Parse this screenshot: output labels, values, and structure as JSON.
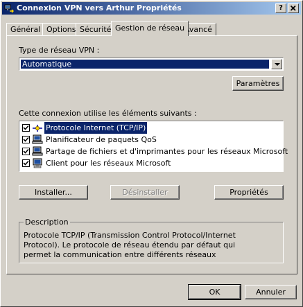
{
  "window": {
    "title": "Connexion VPN vers Arthur Propriétés",
    "help_button": "?",
    "close_button": "✕"
  },
  "tabs": [
    {
      "label": "Général",
      "active": false
    },
    {
      "label": "Options",
      "active": false
    },
    {
      "label": "Sécurité",
      "active": false
    },
    {
      "label": "Gestion de réseau",
      "active": true
    },
    {
      "label": "Avancé",
      "active": false
    }
  ],
  "vpn_type": {
    "label": "Type de réseau VPN :",
    "selected": "Automatique",
    "settings_button": "Paramètres"
  },
  "components": {
    "label": "Cette connexion utilise les éléments suivants :",
    "items": [
      {
        "label": "Protocole Internet (TCP/IP)",
        "checked": true,
        "icon": "network-protocol-icon"
      },
      {
        "label": "Planificateur de paquets QoS",
        "checked": true,
        "icon": "network-service-icon"
      },
      {
        "label": "Partage de fichiers et d'imprimantes pour les réseaux Microsoft",
        "checked": true,
        "icon": "network-service-icon"
      },
      {
        "label": "Client pour les réseaux Microsoft",
        "checked": true,
        "icon": "network-client-icon"
      }
    ]
  },
  "actions": {
    "install": "Installer...",
    "uninstall": "Désinstaller",
    "properties": "Propriétés"
  },
  "description": {
    "title": "Description",
    "text": "Protocole TCP/IP (Transmission Control Protocol/Internet Protocol). Le protocole de réseau étendu par défaut qui permet la communication entre différents réseaux"
  },
  "footer": {
    "ok": "OK",
    "cancel": "Annuler"
  }
}
